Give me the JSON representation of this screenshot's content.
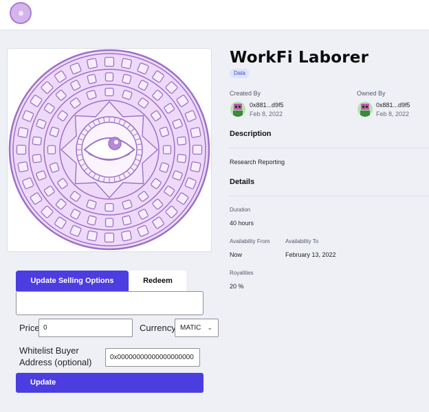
{
  "header": {
    "logo_icon": "workfi-logo-icon"
  },
  "artwork": {
    "icon": "sun-eye-mandala-icon",
    "fill": "#eed9f9",
    "stroke": "#9b71c5"
  },
  "item": {
    "title": "WorkFi Laborer",
    "tag": "Data"
  },
  "created_by": {
    "label": "Created By",
    "address": "0x881...d9f5",
    "date": "Feb 8, 2022"
  },
  "owned_by": {
    "label": "Owned By",
    "address": "0x881...d9f5",
    "date": "Feb 8, 2022"
  },
  "description": {
    "heading": "Description",
    "text": "Research Reporting"
  },
  "details": {
    "heading": "Details",
    "duration_label": "Duration",
    "duration_value": "40 hours",
    "availability_from_label": "Availability From",
    "availability_from_value": "Now",
    "availability_to_label": "Availability To",
    "availability_to_value": "February 13, 2022",
    "royalties_label": "Royalities",
    "royalties_value": "20 %"
  },
  "tabs": [
    {
      "label": "Update Selling Options",
      "active": true
    },
    {
      "label": "Redeem",
      "active": false
    }
  ],
  "form": {
    "price_label": "Price",
    "price_value": "0",
    "currency_label": "Currency",
    "currency_value": "MATIC",
    "whitelist_label_line1": "Whitelist Buyer",
    "whitelist_label_line2": "Address (optional)",
    "whitelist_value": "0x00000000000000000000",
    "update_label": "Update"
  },
  "colors": {
    "accent": "#4b3de0",
    "background": "#eef0f6",
    "tag_bg": "#dfe3fa"
  }
}
